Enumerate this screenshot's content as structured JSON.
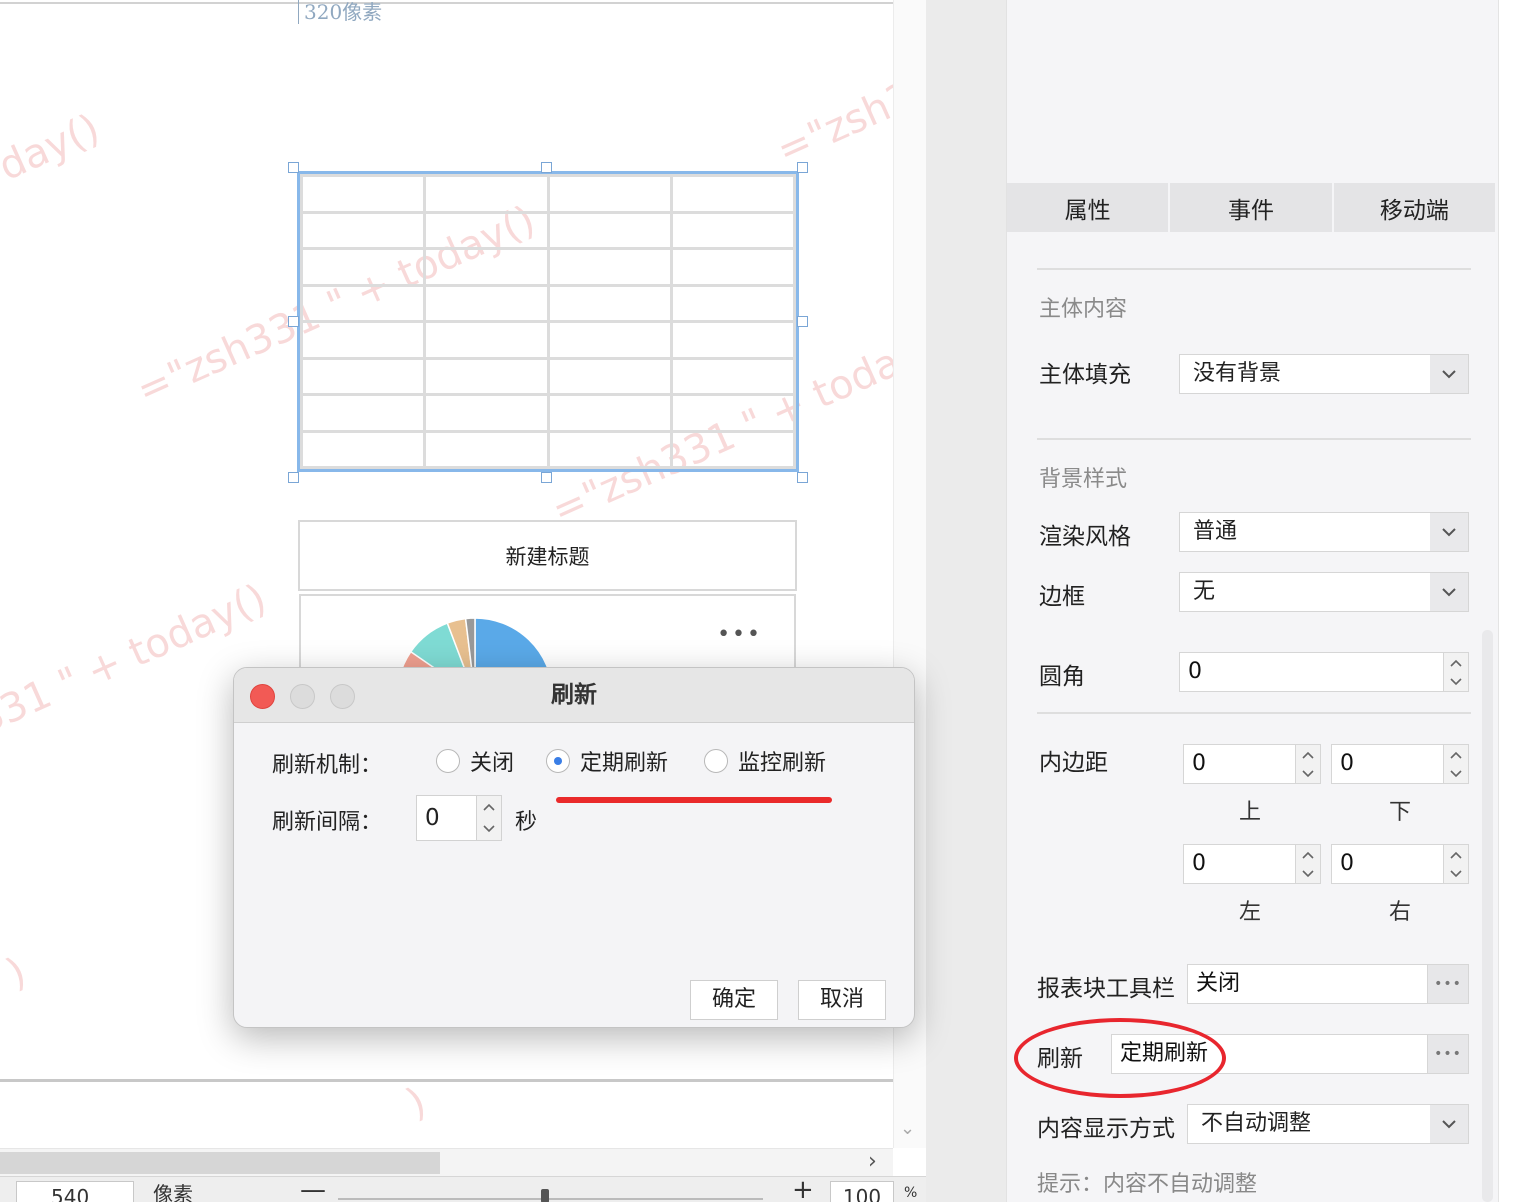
{
  "canvas": {
    "pixel_label": "320像素",
    "watermarks": [
      "day()",
      "=\"zsh33",
      "=\"zsh331 \" + today()",
      "=\"zsh331 \" + today(",
      "331 \" + today()",
      ")",
      ")"
    ],
    "chart_title": "新建标题",
    "chart_menu": "•••"
  },
  "bottom_bar": {
    "width_value": "540",
    "width_unit": "像素",
    "zoom_minus": "—",
    "zoom_plus": "+",
    "zoom_value": "100",
    "zoom_unit": "%",
    "scroll_right": "›",
    "scroll_down": "⌄"
  },
  "panel": {
    "tabs": [
      "属性",
      "事件",
      "移动端"
    ],
    "section_body": "主体内容",
    "body_fill_label": "主体填充",
    "body_fill_value": "没有背景",
    "section_bg": "背景样式",
    "render_label": "渲染风格",
    "render_value": "普通",
    "border_label": "边框",
    "border_value": "无",
    "radius_label": "圆角",
    "radius_value": "0",
    "padding_label": "内边距",
    "padding": {
      "top": "0",
      "bottom": "0",
      "left": "0",
      "right": "0",
      "top_label": "上",
      "bottom_label": "下",
      "left_label": "左",
      "right_label": "右"
    },
    "toolbar_label": "报表块工具栏",
    "toolbar_value": "关闭",
    "refresh_label": "刷新",
    "refresh_value": "定期刷新",
    "display_label": "内容显示方式",
    "display_value": "不自动调整",
    "hint": "提示：内容不自动调整",
    "more_glyph": "•••"
  },
  "dialog": {
    "title": "刷新",
    "mechanism_label": "刷新机制：",
    "options": [
      "关闭",
      "定期刷新",
      "监控刷新"
    ],
    "selected_option": "定期刷新",
    "interval_label": "刷新间隔：",
    "interval_value": "0",
    "interval_unit": "秒",
    "ok": "确定",
    "cancel": "取消"
  },
  "colors": {
    "selection_border": "#88b8ea",
    "annotation_red": "#e8262e",
    "close_button": "#f25a55",
    "radio_selected": "#3a7ee6"
  },
  "chart_data": {
    "type": "pie",
    "values": [
      38,
      6,
      5,
      2,
      1
    ],
    "colors": [
      "#5aa9e8",
      "#f0a090",
      "#7fdbd4",
      "#e8c090",
      "#999999"
    ]
  }
}
